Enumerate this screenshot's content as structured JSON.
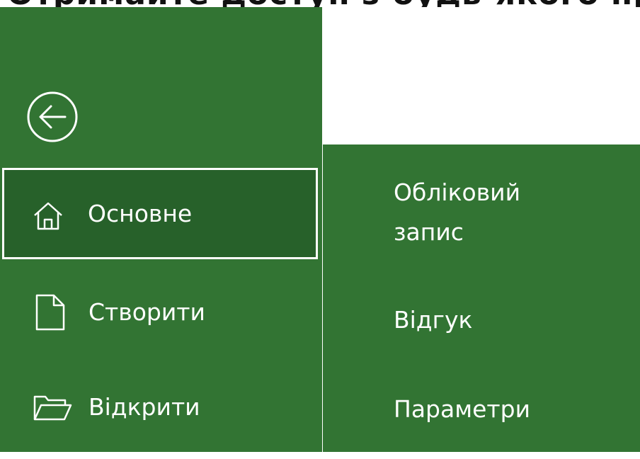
{
  "window": {
    "title_clipped": "Отримайте доступ з будь-якого пристрою"
  },
  "colors": {
    "panel_green": "#327433",
    "selected_green": "#27612a",
    "text": "#ffffff"
  },
  "back": {
    "icon": "back-arrow-circle-icon"
  },
  "nav": {
    "items": [
      {
        "label": "Основне",
        "icon": "home-icon",
        "selected": true
      },
      {
        "label": "Створити",
        "icon": "new-document-icon",
        "selected": false
      },
      {
        "label": "Відкрити",
        "icon": "open-folder-icon",
        "selected": false
      }
    ]
  },
  "more": {
    "items": [
      {
        "line1": "Обліковий",
        "line2": "запис"
      },
      {
        "label": "Відгук"
      },
      {
        "label": "Параметри"
      }
    ]
  }
}
